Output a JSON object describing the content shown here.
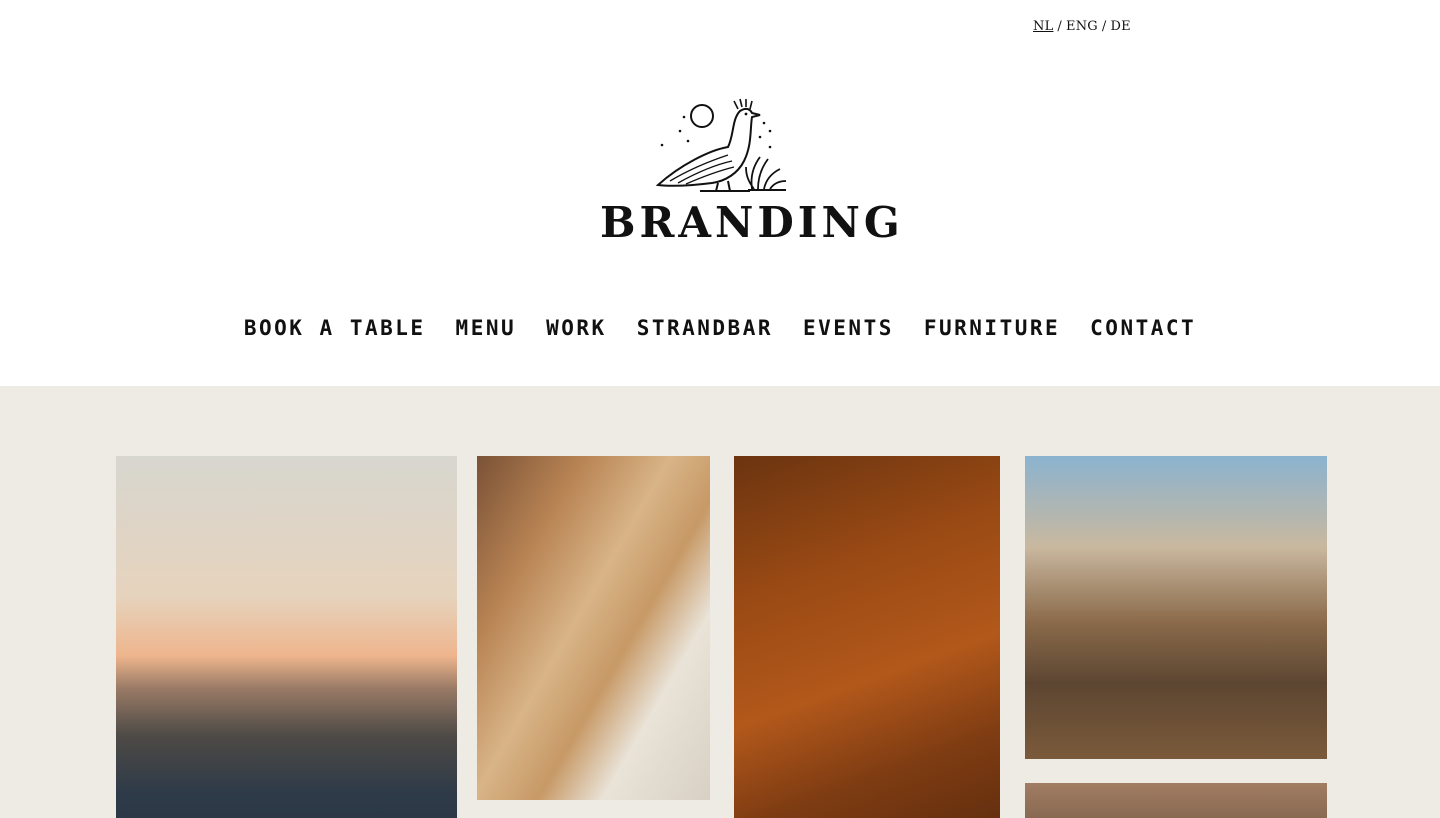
{
  "languages": [
    {
      "label": "NL",
      "active": true
    },
    {
      "label": "ENG",
      "active": false
    },
    {
      "label": "DE",
      "active": false
    }
  ],
  "lang_separator": "/",
  "brand": {
    "name": "BRANDING"
  },
  "nav": [
    {
      "label": "BOOK A TABLE"
    },
    {
      "label": "MENU"
    },
    {
      "label": "WORK"
    },
    {
      "label": "STRANDBAR"
    },
    {
      "label": "EVENTS"
    },
    {
      "label": "FURNITURE"
    },
    {
      "label": "CONTACT"
    }
  ],
  "colors": {
    "header_bg": "#ffffff",
    "gallery_bg": "#eeebe4",
    "text": "#111111"
  }
}
